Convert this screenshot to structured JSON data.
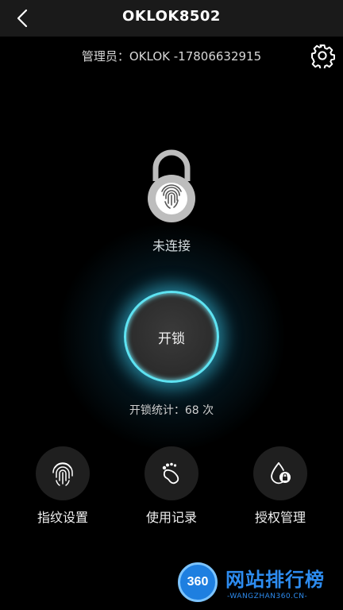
{
  "header": {
    "title": "OKLOK8502",
    "back_icon": "chevron-left-icon"
  },
  "admin": {
    "text": "管理员：OKLOK -17806632915",
    "settings_icon": "gear-icon"
  },
  "lock": {
    "icon": "fingerprint-padlock-icon",
    "status": "未连接"
  },
  "unlock": {
    "label": "开锁",
    "accent": "#5ee3f2"
  },
  "stats": {
    "text": "开锁统计：68 次"
  },
  "features": [
    {
      "label": "指纹设置",
      "icon": "fingerprint-icon"
    },
    {
      "label": "使用记录",
      "icon": "footprint-icon"
    },
    {
      "label": "授权管理",
      "icon": "drop-lock-icon"
    }
  ],
  "watermark": {
    "badge": "360",
    "title": "网站排行榜",
    "subtitle": "-WANGZHAN360.CN-"
  }
}
